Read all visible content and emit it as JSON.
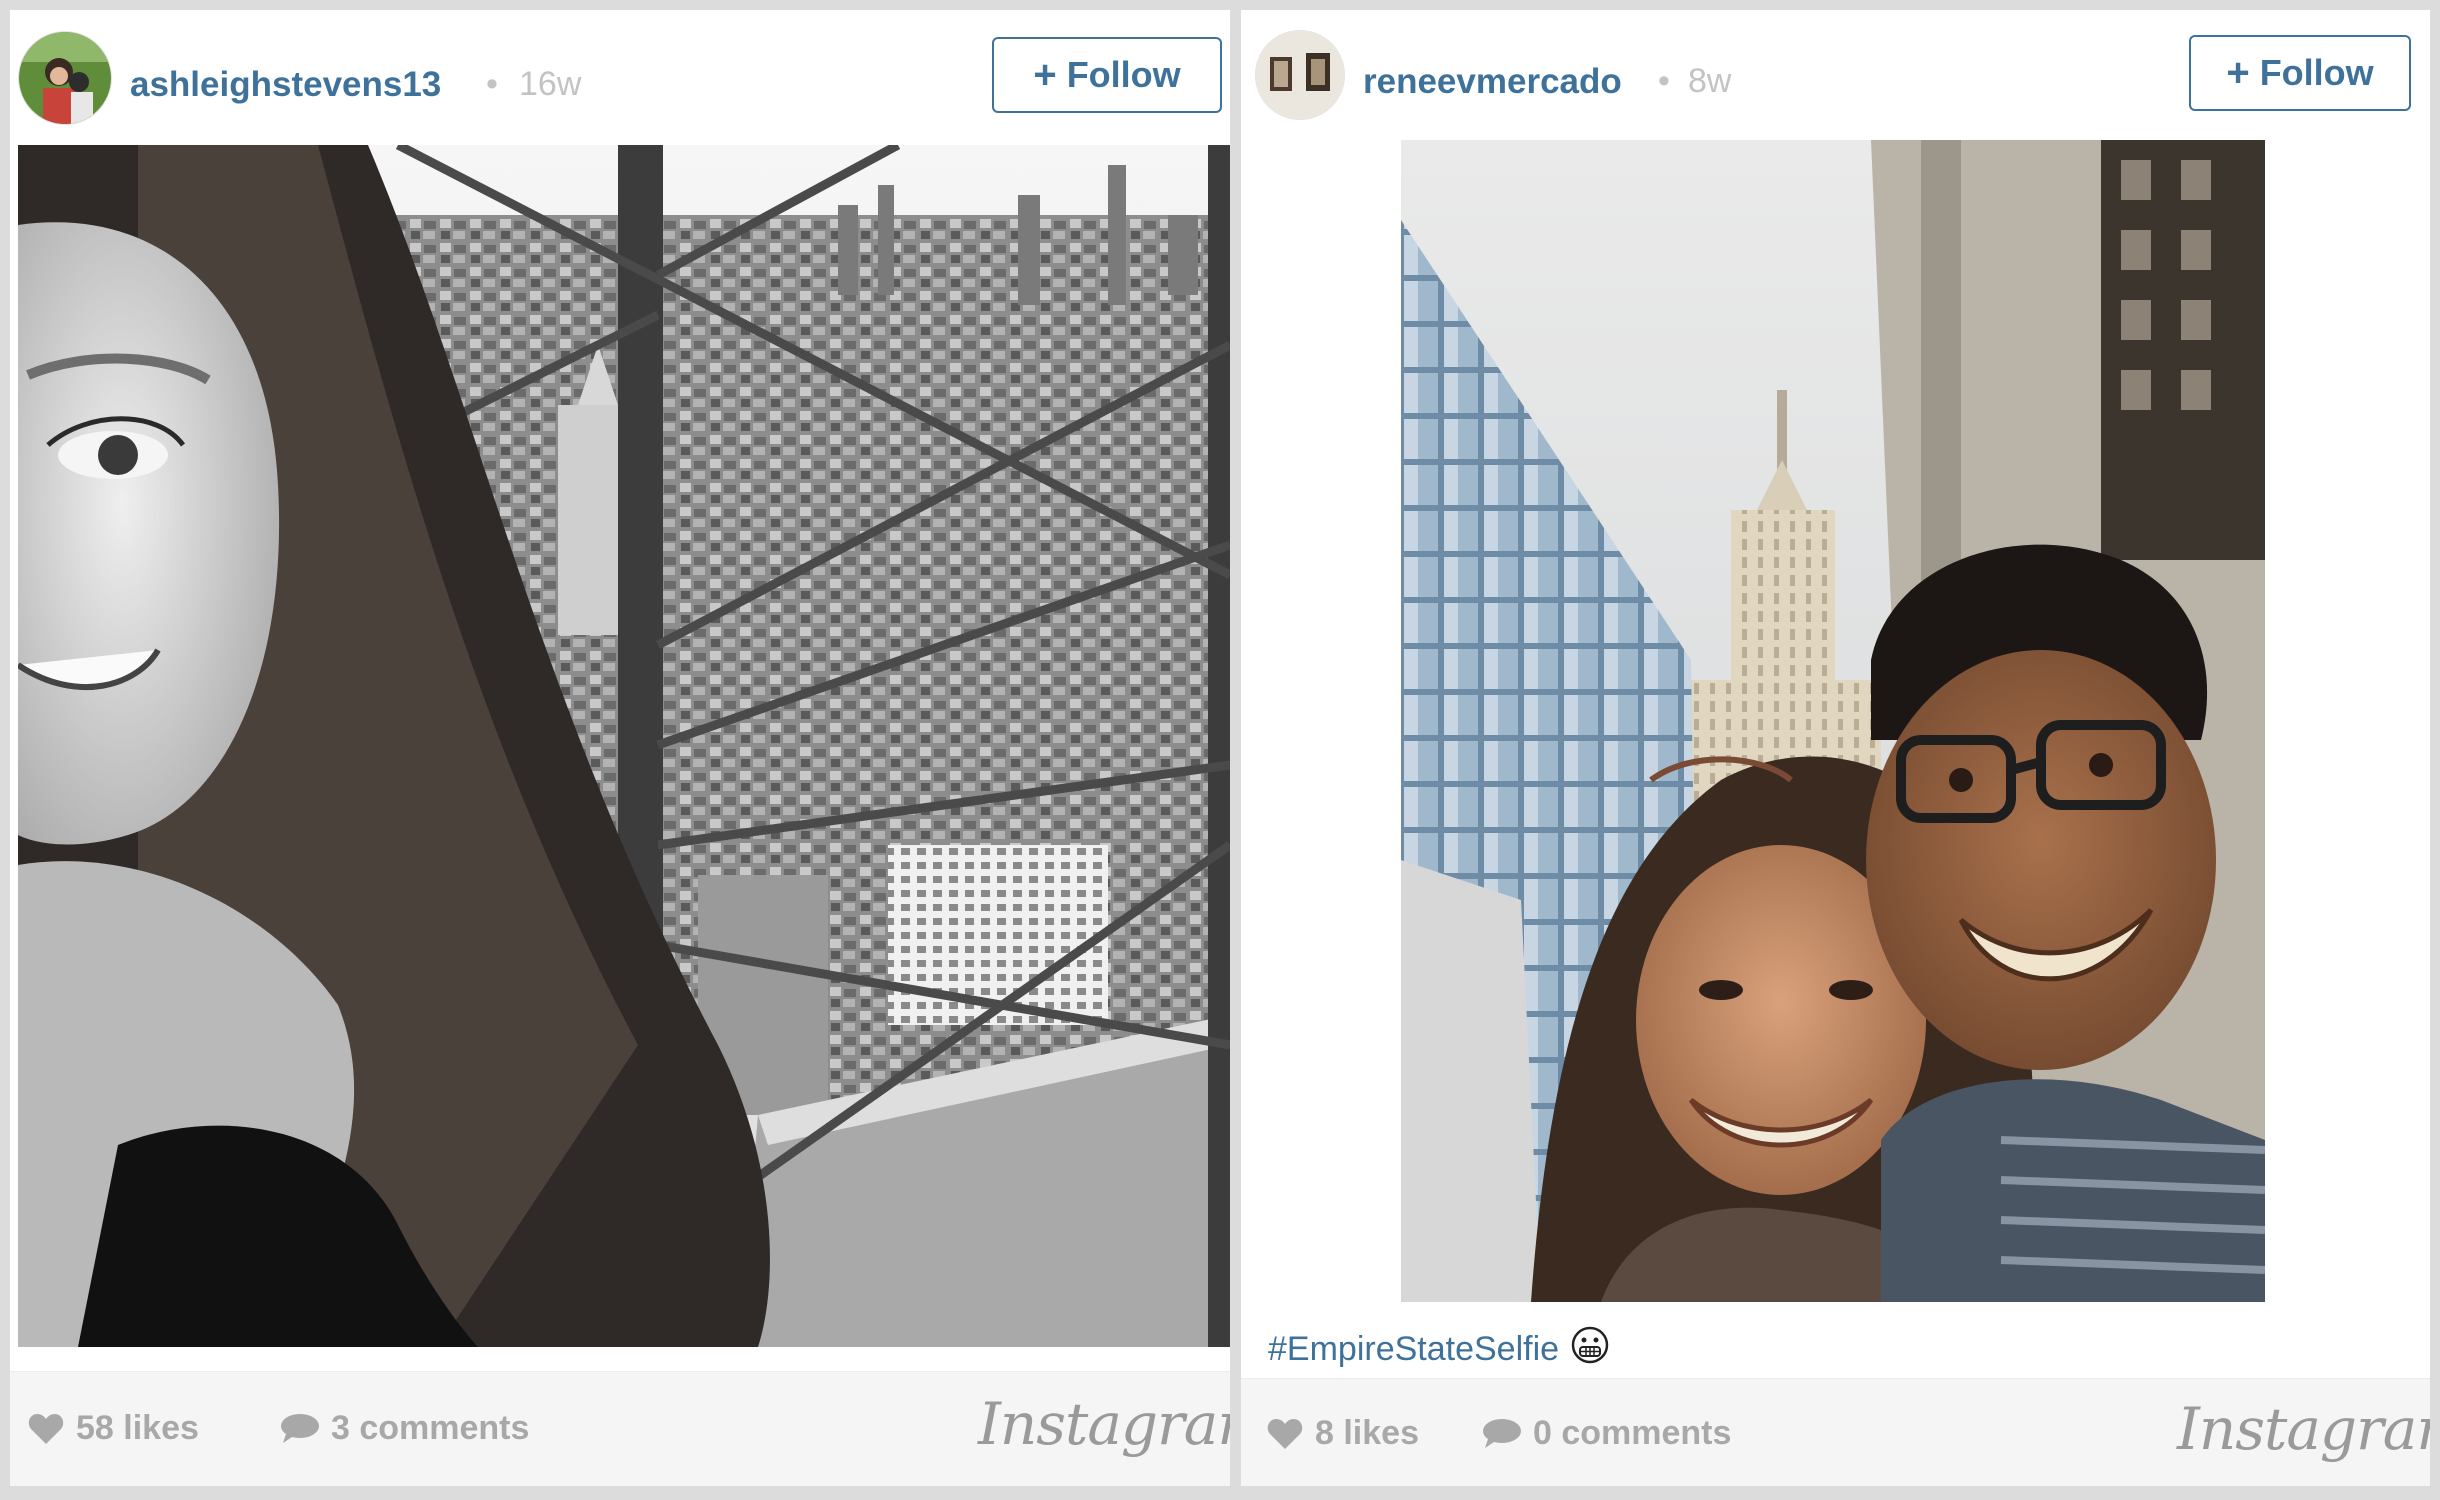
{
  "posts": [
    {
      "username": "ashleighstevens13",
      "separator": "•",
      "age": "16w",
      "follow_label": "Follow",
      "caption": "",
      "likes": "58 likes",
      "comments": "3 comments",
      "brand": "Instagram"
    },
    {
      "username": "reneevmercado",
      "separator": "•",
      "age": "8w",
      "follow_label": "Follow",
      "caption": "#EmpireStateSelfie",
      "caption_emoji": "😬",
      "likes": "8 likes",
      "comments": "0 comments",
      "brand": "Instagram"
    }
  ],
  "colors": {
    "link_blue": "#3f729b",
    "muted_gray": "#a8a8a8",
    "footer_bg": "#f5f5f5"
  },
  "icons": {
    "plus": "plus-icon",
    "likes": "heart-icon",
    "comments": "comment-bubble-icon"
  }
}
